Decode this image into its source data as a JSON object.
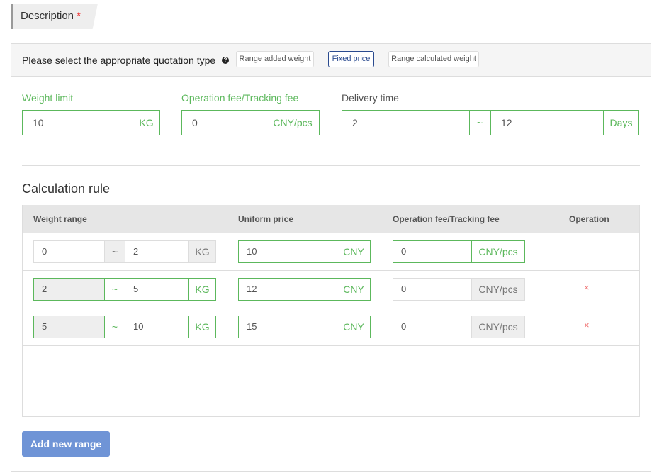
{
  "description": {
    "label": "Description",
    "required": "*"
  },
  "quotation": {
    "prompt": "Please select the appropriate quotation type",
    "help_icon": "?",
    "types": [
      "Range added weight",
      "Fixed price",
      "Range calculated weight"
    ],
    "selected": "Fixed price"
  },
  "fields": {
    "weight_limit": {
      "label": "Weight limit",
      "value": "10",
      "unit": "KG"
    },
    "op_fee": {
      "label": "Operation fee/Tracking fee",
      "value": "0",
      "unit": "CNY/pcs"
    },
    "delivery": {
      "label": "Delivery time",
      "from": "2",
      "sep": "~",
      "to": "12",
      "unit": "Days"
    }
  },
  "calc": {
    "title": "Calculation rule",
    "headers": [
      "Weight range",
      "Uniform price",
      "Operation fee/Tracking fee",
      "Operation"
    ],
    "rows": [
      {
        "from": "0",
        "sep": "~",
        "to": "2",
        "unit": "KG",
        "price": "10",
        "price_unit": "CNY",
        "fee": "0",
        "fee_unit": "CNY/pcs",
        "op": ""
      },
      {
        "from": "2",
        "sep": "~",
        "to": "5",
        "unit": "KG",
        "price": "12",
        "price_unit": "CNY",
        "fee": "0",
        "fee_unit": "CNY/pcs",
        "op": "×"
      },
      {
        "from": "5",
        "sep": "~",
        "to": "10",
        "unit": "KG",
        "price": "15",
        "price_unit": "CNY",
        "fee": "0",
        "fee_unit": "CNY/pcs",
        "op": "×"
      }
    ]
  },
  "add_button": "Add new range"
}
